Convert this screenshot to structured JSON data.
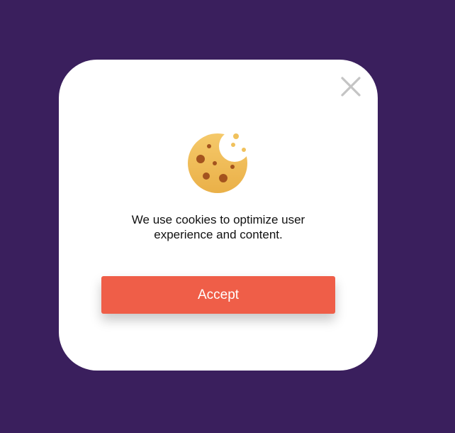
{
  "colors": {
    "backdrop": "#3a1f5d",
    "modal_background": "#ffffff",
    "accept_button": "#ef5e48",
    "close_icon": "#c4c4c4",
    "cookie_base": "#f0c15c",
    "cookie_chip": "#a4531e"
  },
  "cookie_banner": {
    "icon": "cookie-icon",
    "close_icon": "close-icon",
    "message": "We use cookies to optimize user experience and content.",
    "accept_label": "Accept"
  }
}
